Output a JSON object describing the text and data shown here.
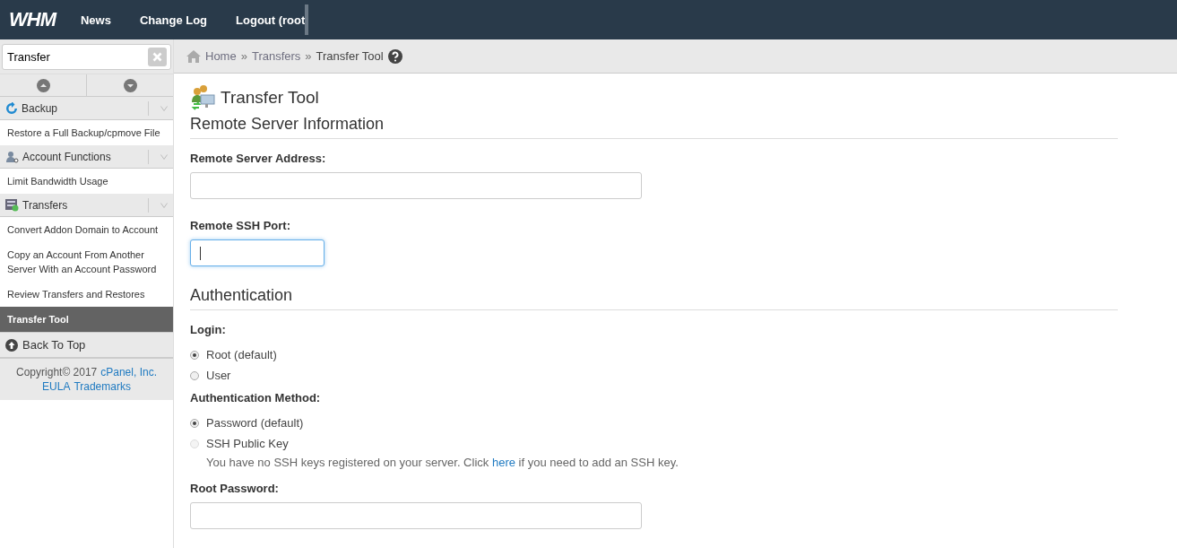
{
  "topbar": {
    "logo": "WHM",
    "nav": [
      "News",
      "Change Log",
      "Logout (root"
    ]
  },
  "sidebar": {
    "search": {
      "value": "Transfer"
    },
    "groups": [
      {
        "kind": "backup",
        "title": "Backup",
        "items": [
          {
            "label": "Restore a Full Backup/cpmove File",
            "selected": false
          }
        ]
      },
      {
        "kind": "account",
        "title": "Account Functions",
        "items": [
          {
            "label": "Limit Bandwidth Usage",
            "selected": false
          }
        ]
      },
      {
        "kind": "transfers",
        "title": "Transfers",
        "items": [
          {
            "label": "Convert Addon Domain to Account",
            "selected": false
          },
          {
            "label": "Copy an Account From Another Server With an Account Password",
            "selected": false
          },
          {
            "label": "Review Transfers and Restores",
            "selected": false
          },
          {
            "label": "Transfer Tool",
            "selected": true
          }
        ]
      }
    ],
    "back_to_top": "Back To Top",
    "copyright": {
      "text": "Copyright© 2017",
      "company": "cPanel, Inc.",
      "links": [
        "EULA",
        "Trademarks"
      ]
    }
  },
  "breadcrumb": [
    "Home",
    "Transfers",
    "Transfer Tool"
  ],
  "breadcrumb_separator": "»",
  "page_title": "Transfer Tool",
  "sections": [
    {
      "heading": "Remote Server Information",
      "fields": [
        {
          "kind": "text",
          "label": "Remote Server Address:",
          "focused": false
        },
        {
          "kind": "short_text",
          "label": "Remote SSH Port:",
          "focused": true
        }
      ]
    },
    {
      "heading": "Authentication",
      "fields": [
        {
          "kind": "radio",
          "label": "Login:",
          "options": [
            {
              "label": "Root (default)",
              "selected": true,
              "disabled": false
            },
            {
              "label": "User",
              "selected": false,
              "disabled": false
            }
          ]
        },
        {
          "kind": "radio",
          "label": "Authentication Method:",
          "options": [
            {
              "label": "Password (default)",
              "selected": true,
              "disabled": false
            },
            {
              "label": "SSH Public Key",
              "selected": false,
              "disabled": true
            }
          ],
          "note": {
            "before": "You have no SSH keys registered on your server. Click",
            "link": "here",
            "after": "if you need to add an SSH key."
          }
        },
        {
          "kind": "text",
          "label": "Root Password:",
          "focused": false
        }
      ]
    }
  ]
}
